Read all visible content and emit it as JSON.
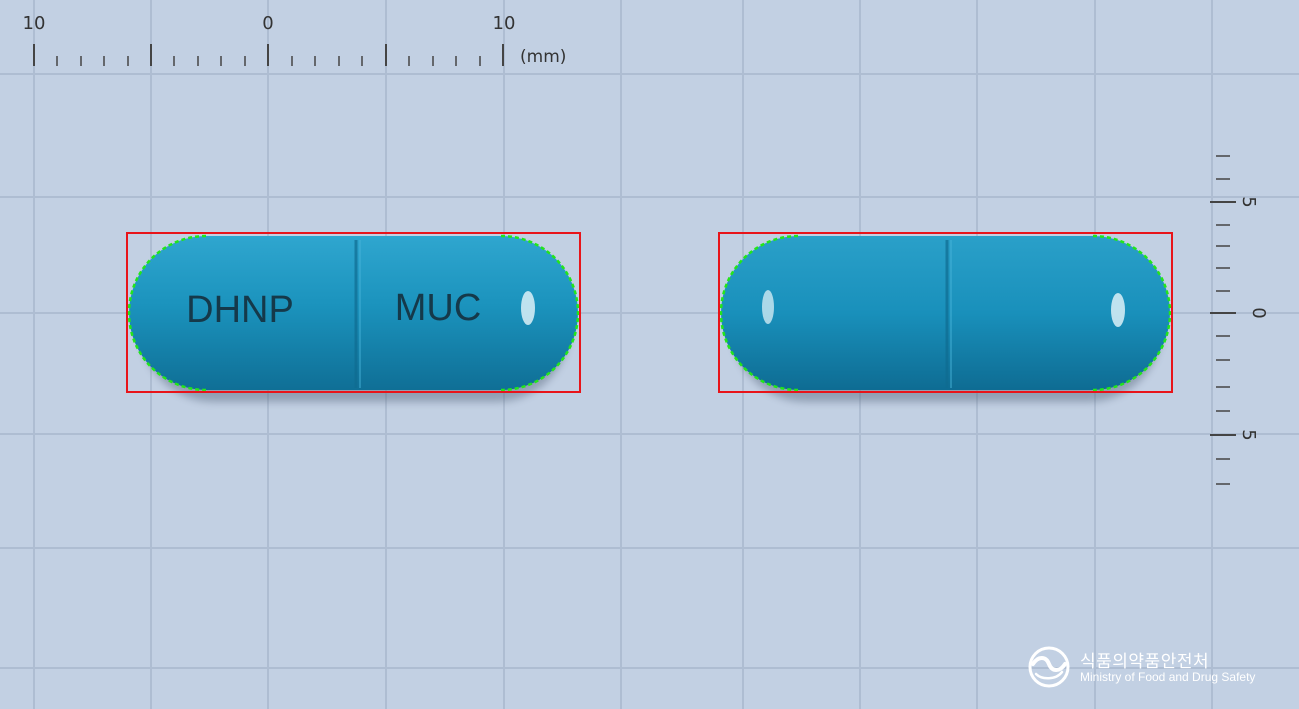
{
  "scale": {
    "horizontal_labels": [
      "10",
      "0",
      "10"
    ],
    "horizontal_unit": "(mm)",
    "vertical_labels": [
      "5",
      "0",
      "5"
    ]
  },
  "capsules": [
    {
      "view": "front",
      "imprint_left": "DHNP",
      "imprint_right": "MUC"
    },
    {
      "view": "back",
      "imprint_left": "",
      "imprint_right": ""
    }
  ],
  "colors": {
    "background": "#c2d0e3",
    "capsule_body": "#1a8fb8",
    "bounding_box": "#e8141a",
    "contour": "#22e61a"
  },
  "logo": {
    "name_ko": "식품의약품안전처",
    "name_en": "Ministry of Food and Drug Safety"
  }
}
